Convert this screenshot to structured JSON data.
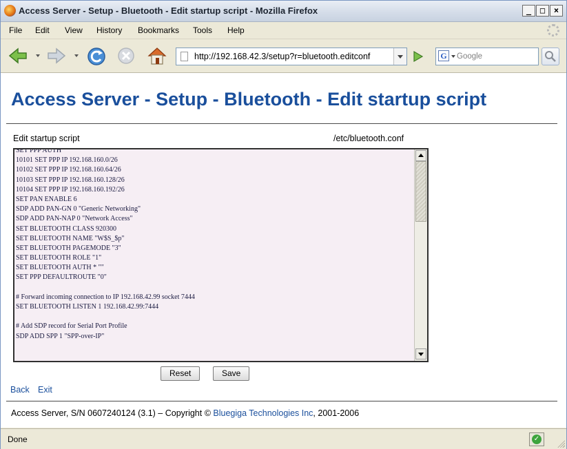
{
  "window": {
    "title": "Access Server - Setup - Bluetooth - Edit startup script - Mozilla Firefox",
    "minimize_glyph": "_",
    "maximize_glyph": "□",
    "close_glyph": "×"
  },
  "menubar": {
    "items": [
      "File",
      "Edit",
      "View",
      "History",
      "Bookmarks",
      "Tools",
      "Help"
    ]
  },
  "navbar": {
    "url": "http://192.168.42.3/setup?r=bluetooth.editconf",
    "search_placeholder": "Google",
    "search_engine_letter": "G"
  },
  "page": {
    "title": "Access Server - Setup - Bluetooth - Edit startup script",
    "editor_label": "Edit startup script",
    "editor_file": "/etc/bluetooth.conf",
    "editor_lines": [
      "SET PPP AUTH",
      "10101 SET PPP IP 192.168.160.0/26",
      "10102 SET PPP IP 192.168.160.64/26",
      "10103 SET PPP IP 192.168.160.128/26",
      "10104 SET PPP IP 192.168.160.192/26",
      "SET PAN ENABLE 6",
      "SDP ADD PAN-GN 0 \"Generic Networking\"",
      "SDP ADD PAN-NAP 0 \"Network Access\"",
      "SET BLUETOOTH CLASS 920300",
      "SET BLUETOOTH NAME \"W$S_$p\"",
      "SET BLUETOOTH PAGEMODE \"3\"",
      "SET BLUETOOTH ROLE \"1\"",
      "SET BLUETOOTH AUTH * \"\"",
      "SET PPP DEFAULTROUTE \"0\"",
      "",
      "# Forward incoming connection to IP 192.168.42.99 socket 7444",
      "SET BLUETOOTH LISTEN 1 192.168.42.99:7444",
      "",
      "# Add SDP record for Serial Port Profile",
      "SDP ADD SPP 1 \"SPP-over-IP\""
    ],
    "reset_label": "Reset",
    "save_label": "Save",
    "back_label": "Back",
    "exit_label": "Exit",
    "footer_prefix": "Access Server, S/N 0607240124 (3.1)  –  Copyright ©",
    "footer_company": "Bluegiga Technologies Inc",
    "footer_suffix": ", 2001-2006"
  },
  "statusbar": {
    "text": "Done"
  },
  "colors": {
    "title_blue": "#1a4f9c",
    "link_blue": "#1a4f9c",
    "editor_bg": "#f6eef4"
  }
}
